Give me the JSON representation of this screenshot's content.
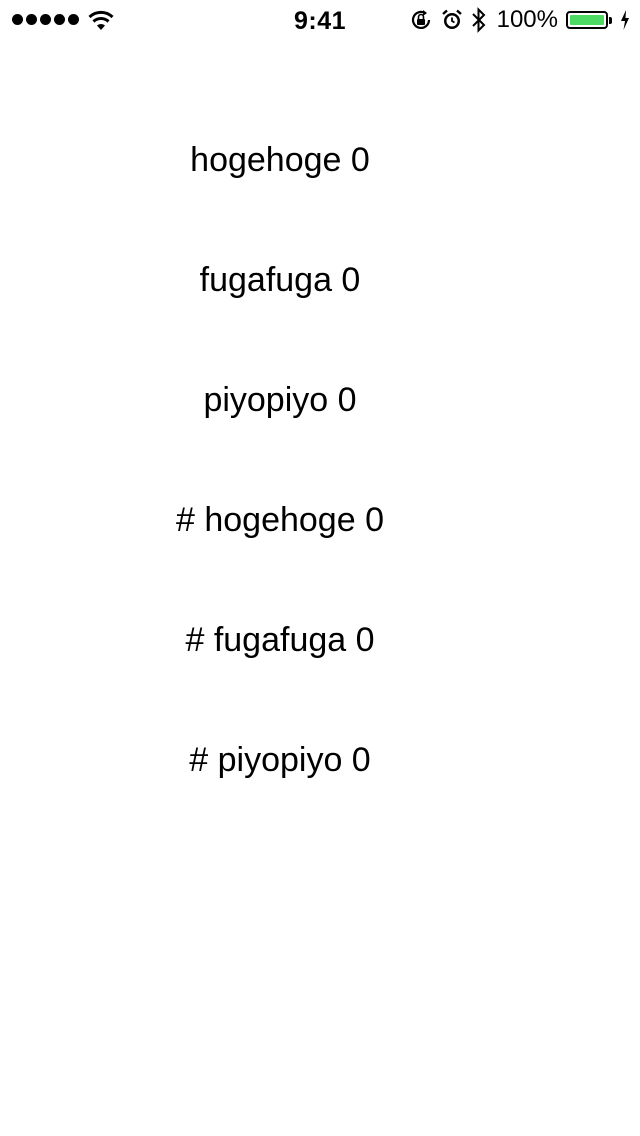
{
  "status_bar": {
    "time": "9:41",
    "battery_percent": "100%",
    "signal_bars": 5,
    "battery_level": 1.0,
    "battery_color": "#4cd964",
    "icons": [
      "signal-dots-icon",
      "wifi-icon",
      "rotation-lock-icon",
      "alarm-icon",
      "bluetooth-icon",
      "battery-icon",
      "charging-bolt-icon"
    ]
  },
  "labels": [
    "hogehoge 0",
    "fugafuga 0",
    "piyopiyo 0",
    "# hogehoge 0",
    "# fugafuga 0",
    "# piyopiyo 0"
  ]
}
